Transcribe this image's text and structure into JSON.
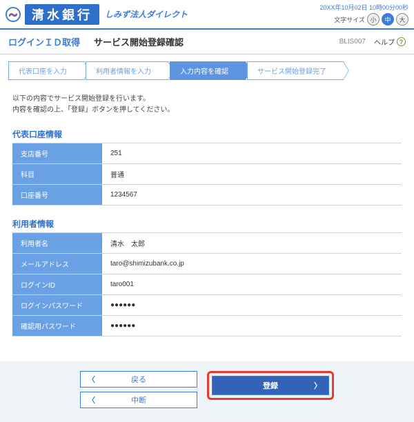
{
  "header": {
    "bank_name": "清水銀行",
    "tagline": "しみず法人ダイレクト",
    "timestamp": "20XX年10月02日 10時00分00秒",
    "fontsize_label": "文字サイズ",
    "fs_small": "小",
    "fs_medium": "中",
    "fs_large": "大"
  },
  "subheader": {
    "title": "ログインＩＤ取得",
    "subtitle": "サービス開始登録確認",
    "screen_id": "BLIS007",
    "help_label": "ヘルプ"
  },
  "steps": {
    "s1": "代表口座を入力",
    "s2": "利用者情報を入力",
    "s3": "入力内容を確認",
    "s4": "サービス開始登録完了"
  },
  "instruction": {
    "l1": "以下の内容でサービス開始登録を行います。",
    "l2": "内容を確認の上、「登録」ボタンを押してください。"
  },
  "section1": {
    "title": "代表口座情報",
    "rows": [
      {
        "label": "支店番号",
        "value": "251"
      },
      {
        "label": "科目",
        "value": "普通"
      },
      {
        "label": "口座番号",
        "value": "1234567"
      }
    ]
  },
  "section2": {
    "title": "利用者情報",
    "rows": [
      {
        "label": "利用者名",
        "value": "清水　太郎"
      },
      {
        "label": "メールアドレス",
        "value": "taro@shimizubank.co.jp"
      },
      {
        "label": "ログインID",
        "value": "taro001"
      },
      {
        "label": "ログインパスワード",
        "value": "●●●●●●"
      },
      {
        "label": "確認用パスワード",
        "value": "●●●●●●"
      }
    ]
  },
  "buttons": {
    "back": "戻る",
    "cancel": "中断",
    "submit": "登録"
  }
}
